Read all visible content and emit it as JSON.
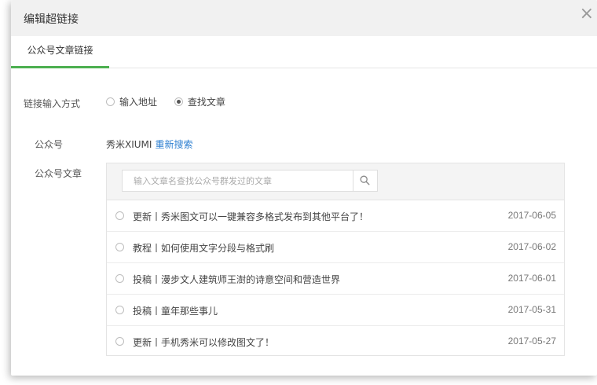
{
  "dialog": {
    "title": "编辑超链接",
    "close_glyph": "×"
  },
  "tabs": [
    {
      "label": "公众号文章链接",
      "active": true
    }
  ],
  "link_mode": {
    "label": "链接输入方式",
    "options": [
      {
        "label": "输入地址",
        "checked": false
      },
      {
        "label": "查找文章",
        "checked": true
      }
    ]
  },
  "account": {
    "label": "公众号",
    "name": "秀米XIUMI",
    "research_label": "重新搜索"
  },
  "articles": {
    "label": "公众号文章",
    "search_placeholder": "输入文章名查找公众号群发过的文章",
    "search_icon": "search-icon",
    "items": [
      {
        "title": "更新丨秀米图文可以一键兼容多格式发布到其他平台了！",
        "date": "2017-06-05"
      },
      {
        "title": "教程丨如何使用文字分段与格式刷",
        "date": "2017-06-02"
      },
      {
        "title": "投稿丨漫步文人建筑师王澍的诗意空间和营造世界",
        "date": "2017-06-01"
      },
      {
        "title": "投稿丨童年那些事儿",
        "date": "2017-05-31"
      },
      {
        "title": "更新丨手机秀米可以修改图文了！",
        "date": "2017-05-27"
      }
    ]
  },
  "colors": {
    "accent_green": "#4caf50",
    "link_blue": "#2f80d1"
  }
}
